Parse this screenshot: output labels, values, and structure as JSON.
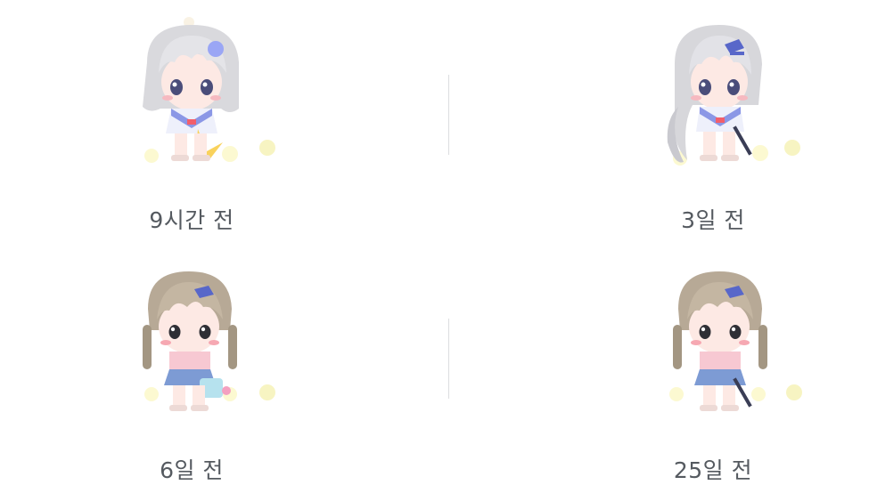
{
  "history": {
    "items": [
      {
        "time": "9시간 전",
        "avatar_icon": "character-avatar-silver-bob-icon"
      },
      {
        "time": "3일 전",
        "avatar_icon": "character-avatar-silver-long-icon"
      },
      {
        "time": "6일 전",
        "avatar_icon": "character-avatar-brown-braids-bag-icon"
      },
      {
        "time": "25일 전",
        "avatar_icon": "character-avatar-brown-braids-icon"
      }
    ]
  },
  "colors": {
    "label_text": "#555a60",
    "divider": "#dcdde0",
    "background": "#ffffff"
  }
}
